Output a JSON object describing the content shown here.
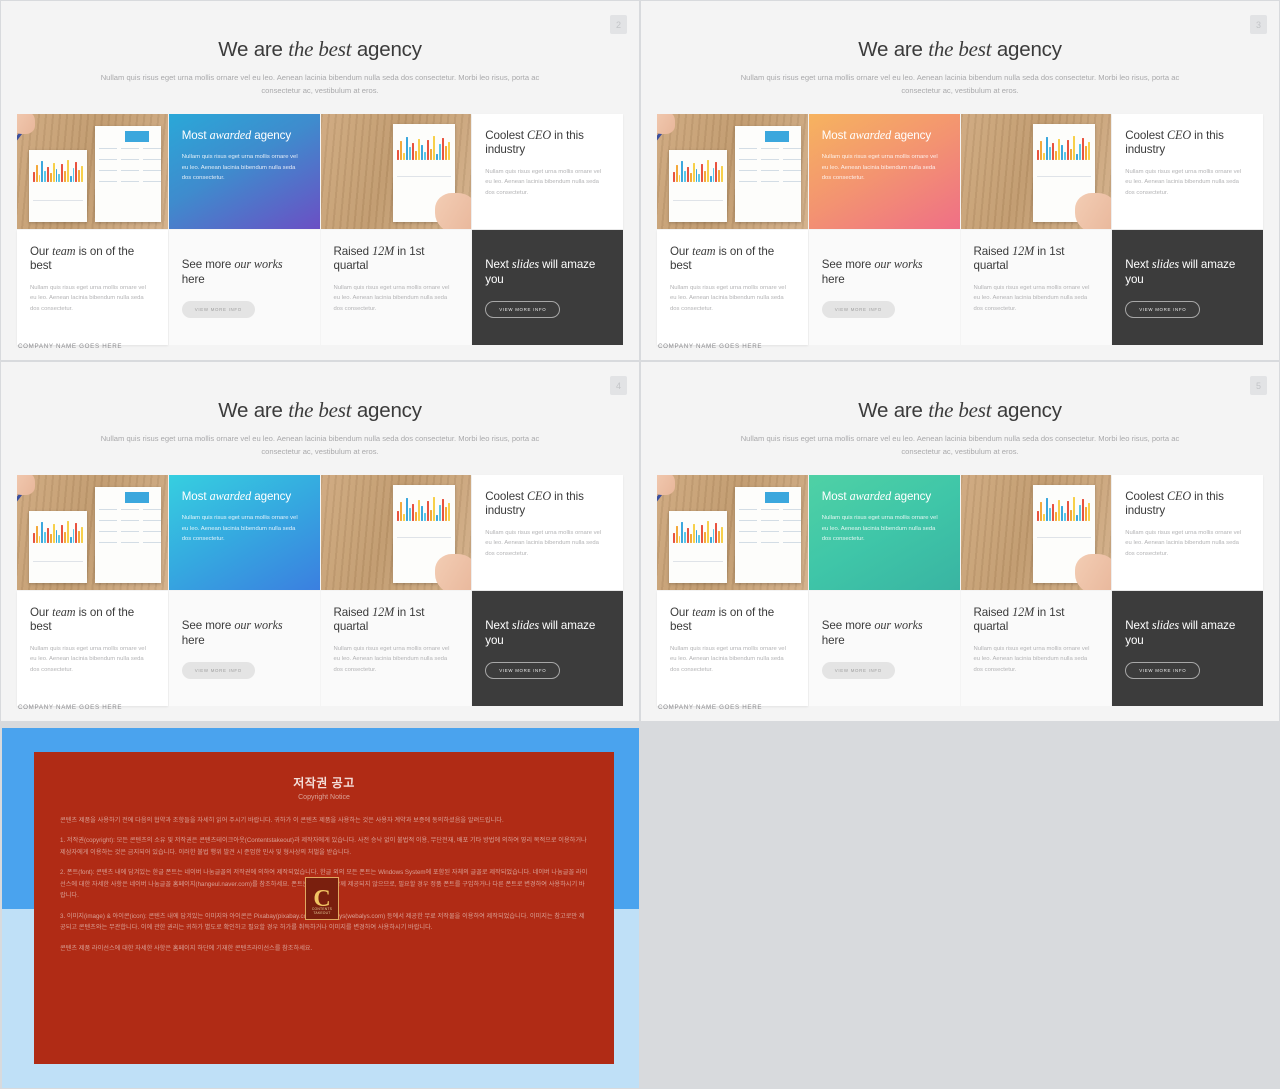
{
  "slides": [
    {
      "badge": "2",
      "title_pre": "We are ",
      "title_em": "the best",
      "title_post": " agency",
      "subtitle": "Nullam quis risus eget urna mollis ornare vel eu leo. Aenean lacinia bibendum nulla seda dos consectetur. Morbi leo risus, porta ac consectetur ac, vestibulum at eros.",
      "gradient": "linear-gradient(150deg, #2aa8d8 0%, #3f8bcd 45%, #6b4fc4 100%)",
      "accent": "#2aa8d8",
      "cards": {
        "awarded_h_pre": "Most ",
        "awarded_h_em": "awarded",
        "awarded_h_post": " agency",
        "awarded_p": "Nullam quis risus eget urna mollis ornare vel eu leo. Aenean lacinia bibendum nulla seda dos consectetur.",
        "ceo_h_pre": "Coolest ",
        "ceo_h_em": "CEO",
        "ceo_h_post": " in this industry",
        "ceo_p": "Nullam quis risus eget urna mollis ornare vel eu leo. Aenean lacinia bibendum nulla seda dos consectetur.",
        "team_h_pre": "Our ",
        "team_h_em": "team",
        "team_h_post": " is on of the best",
        "team_p": "Nullam quis risus eget urna mollis ornare vel eu leo. Aenean lacinia bibendum nulla seda dos consectetur.",
        "works_h_pre": "See more ",
        "works_h_em": "our works",
        "works_h_post": " here",
        "works_btn": "VIEW MORE INFO",
        "raised_h_pre": "Raised ",
        "raised_h_em": "12M",
        "raised_h_post": " in 1st quartal",
        "raised_p": "Nullam quis risus eget urna mollis ornare vel eu leo. Aenean lacinia bibendum nulla seda dos consectetur.",
        "next_h_pre": "Next ",
        "next_h_em": "slides",
        "next_h_post": " will amaze you",
        "next_btn": "VIEW MORE INFO"
      },
      "footer": "COMPANY NAME GOES HERE"
    },
    {
      "badge": "3",
      "title_pre": "We are ",
      "title_em": "the best",
      "title_post": " agency",
      "subtitle": "Nullam quis risus eget urna mollis ornare vel eu leo. Aenean lacinia bibendum nulla seda dos consectetur. Morbi leo risus, porta ac consectetur ac, vestibulum at eros.",
      "gradient": "linear-gradient(150deg, #f6b35f 0%, #f39371 50%, #ef6f86 100%)",
      "accent": "#f39371",
      "cards": {
        "awarded_h_pre": "Most ",
        "awarded_h_em": "awarded",
        "awarded_h_post": " agency",
        "awarded_p": "Nullam quis risus eget urna mollis ornare vel eu leo. Aenean lacinia bibendum nulla seda dos consectetur.",
        "ceo_h_pre": "Coolest ",
        "ceo_h_em": "CEO",
        "ceo_h_post": " in this industry",
        "ceo_p": "Nullam quis risus eget urna mollis ornare vel eu leo. Aenean lacinia bibendum nulla seda dos consectetur.",
        "team_h_pre": "Our ",
        "team_h_em": "team",
        "team_h_post": " is on of the best",
        "team_p": "Nullam quis risus eget urna mollis ornare vel eu leo. Aenean lacinia bibendum nulla seda dos consectetur.",
        "works_h_pre": "See more ",
        "works_h_em": "our works",
        "works_h_post": " here",
        "works_btn": "VIEW MORE INFO",
        "raised_h_pre": "Raised ",
        "raised_h_em": "12M",
        "raised_h_post": " in 1st quartal",
        "raised_p": "Nullam quis risus eget urna mollis ornare vel eu leo. Aenean lacinia bibendum nulla seda dos consectetur.",
        "next_h_pre": "Next ",
        "next_h_em": "slides",
        "next_h_post": " will amaze you",
        "next_btn": "VIEW MORE INFO"
      },
      "footer": "COMPANY NAME GOES HERE"
    },
    {
      "badge": "4",
      "title_pre": "We are ",
      "title_em": "the best",
      "title_post": " agency",
      "subtitle": "Nullam quis risus eget urna mollis ornare vel eu leo. Aenean lacinia bibendum nulla seda dos consectetur. Morbi leo risus, porta ac consectetur ac, vestibulum at eros.",
      "gradient": "linear-gradient(150deg, #36cfe0 0%, #35a8e0 50%, #3b7fe0 100%)",
      "accent": "#35a8e0",
      "cards": {
        "awarded_h_pre": "Most ",
        "awarded_h_em": "awarded",
        "awarded_h_post": " agency",
        "awarded_p": "Nullam quis risus eget urna mollis ornare vel eu leo. Aenean lacinia bibendum nulla seda dos consectetur.",
        "ceo_h_pre": "Coolest ",
        "ceo_h_em": "CEO",
        "ceo_h_post": " in this industry",
        "ceo_p": "Nullam quis risus eget urna mollis ornare vel eu leo. Aenean lacinia bibendum nulla seda dos consectetur.",
        "team_h_pre": "Our ",
        "team_h_em": "team",
        "team_h_post": " is on of the best",
        "team_p": "Nullam quis risus eget urna mollis ornare vel eu leo. Aenean lacinia bibendum nulla seda dos consectetur.",
        "works_h_pre": "See more ",
        "works_h_em": "our works",
        "works_h_post": " here",
        "works_btn": "VIEW MORE INFO",
        "raised_h_pre": "Raised ",
        "raised_h_em": "12M",
        "raised_h_post": " in 1st quartal",
        "raised_p": "Nullam quis risus eget urna mollis ornare vel eu leo. Aenean lacinia bibendum nulla seda dos consectetur.",
        "next_h_pre": "Next ",
        "next_h_em": "slides",
        "next_h_post": " will amaze you",
        "next_btn": "VIEW MORE INFO"
      },
      "footer": "COMPANY NAME GOES HERE"
    },
    {
      "badge": "5",
      "title_pre": "We are ",
      "title_em": "the best",
      "title_post": " agency",
      "subtitle": "Nullam quis risus eget urna mollis ornare vel eu leo. Aenean lacinia bibendum nulla seda dos consectetur. Morbi leo risus, porta ac consectetur ac, vestibulum at eros.",
      "gradient": "linear-gradient(150deg, #4fd1a5 0%, #3fc6a8 50%, #39b4a2 100%)",
      "accent": "#3fc6a8",
      "cards": {
        "awarded_h_pre": "Most ",
        "awarded_h_em": "awarded",
        "awarded_h_post": " agency",
        "awarded_p": "Nullam quis risus eget urna mollis ornare vel eu leo. Aenean lacinia bibendum nulla seda dos consectetur.",
        "ceo_h_pre": "Coolest ",
        "ceo_h_em": "CEO",
        "ceo_h_post": " in this industry",
        "ceo_p": "Nullam quis risus eget urna mollis ornare vel eu leo. Aenean lacinia bibendum nulla seda dos consectetur.",
        "team_h_pre": "Our ",
        "team_h_em": "team",
        "team_h_post": " is on of the best",
        "team_p": "Nullam quis risus eget urna mollis ornare vel eu leo. Aenean lacinia bibendum nulla seda dos consectetur.",
        "works_h_pre": "See more ",
        "works_h_em": "our works",
        "works_h_post": " here",
        "works_btn": "VIEW MORE INFO",
        "raised_h_pre": "Raised ",
        "raised_h_em": "12M",
        "raised_h_post": " in 1st quartal",
        "raised_p": "Nullam quis risus eget urna mollis ornare vel eu leo. Aenean lacinia bibendum nulla seda dos consectetur.",
        "next_h_pre": "Next ",
        "next_h_em": "slides",
        "next_h_post": " will amaze you",
        "next_btn": "VIEW MORE INFO"
      },
      "footer": "COMPANY NAME GOES HERE"
    }
  ],
  "copyright": {
    "title": "저작권 공고",
    "subtitle": "Copyright Notice",
    "paragraphs": [
      "콘텐츠 제품을 사용하기 전에 다음의 협약과 조항들을 자세히 읽어 주시기 바랍니다. 귀하가 이 콘텐츠 제품을 사용하는 것은 사용자 계약과 보증에 동의하셨음을 알려드립니다.",
      "1. 저작권(copyright): 모든 콘텐츠의 소유 및 저작권은 콘텐츠테이크아웃(Contentstakeout)과 제작자에게 있습니다. 사전 승낙 없이 불법적 이용, 무단전재, 배포 기타 방법에 의하여 영리 목적으로 이용하거나 제삼자에게 이용하는 것은 금지되어 있습니다. 이러한 불법 행위 발견 시 준엄한 민사 및 형사상의 처벌을 받습니다.",
      "2. 폰트(font): 콘텐츠 내에 담겨있는 한글 폰트는 네이버 나눔글꼴의 저작권에 의하여 제작되었습니다. 한글 외의 모든 폰트는 Windows System에 포함된 자체의 글꼴로 제작되었습니다. 네이버 나눔글꼴 라이선스에 대한 자세한 사항은 네이버 나눔글꼴 홈페이지(hangeul.naver.com)를 참조하세요. 폰트는 콘텐츠와 함께 제공되지 않으므로, 필요할 경우 정품 폰트를 구입하거나 다른 폰트로 변경하여 사용하시기 바랍니다.",
      "3. 이미지(image) & 아이콘(icon): 콘텐츠 내에 담겨있는 이미지와 아이콘은 Pixabay(pixabay.com)와 Webalys(webalys.com) 등에서 제공한 무료 저작물을 이용하여 제작되었습니다. 이미지는 참고로만 제공되고 콘텐츠와는 무관합니다. 이에 관한 권리는 귀하가 별도로 확인하고 필요할 경우 허가를 취득하거나 이미지를 변경하여 사용하시기 바랍니다.",
      "콘텐츠 제품 라이선스에 대한 자세한 사항은 홈페이지 하단에 기재한 콘텐츠라이선스를 참조하세요."
    ],
    "badge_letter": "C",
    "badge_tag": "CONTENTS TAKEOUT"
  }
}
